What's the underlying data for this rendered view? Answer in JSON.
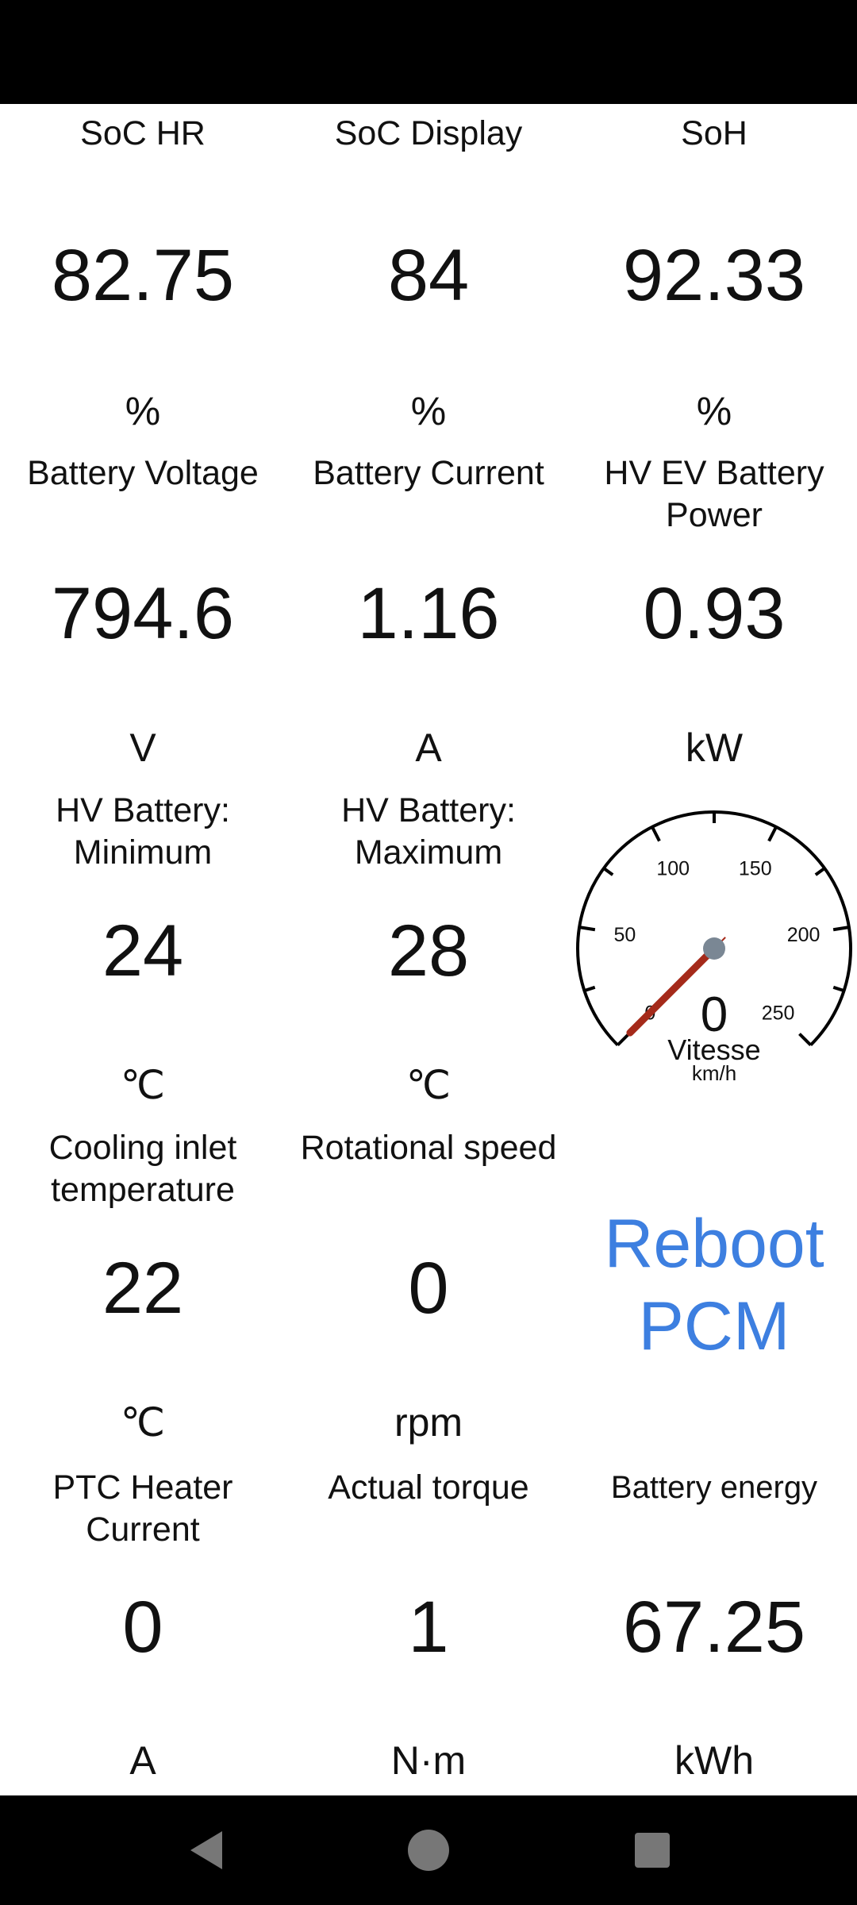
{
  "colors": {
    "accent": "#3d7fe0",
    "needle": "#a52a1a",
    "hub": "#7a8794"
  },
  "cells": [
    {
      "label": "SoC HR",
      "value": "82.75",
      "unit": "%"
    },
    {
      "label": "SoC Display",
      "value": "84",
      "unit": "%"
    },
    {
      "label": "SoH",
      "value": "92.33",
      "unit": "%"
    },
    {
      "label": "Battery Voltage",
      "value": "794.6",
      "unit": "V"
    },
    {
      "label": "Battery Current",
      "value": "1.16",
      "unit": "A"
    },
    {
      "label": "HV EV Battery Power",
      "value": "0.93",
      "unit": "kW"
    },
    {
      "label": "HV Battery: Minimum",
      "value": "24",
      "unit": "℃"
    },
    {
      "label": "HV Battery: Maximum",
      "value": "28",
      "unit": "℃"
    },
    {
      "label": "Cooling inlet temperature",
      "value": "22",
      "unit": "℃"
    },
    {
      "label": "Rotational speed",
      "value": "0",
      "unit": "rpm"
    },
    {
      "label": "PTC Heater Current",
      "value": "0",
      "unit": "A"
    },
    {
      "label": "Actual torque",
      "value": "1",
      "unit": "N·m"
    },
    {
      "label": "Battery energy",
      "value": "67.25",
      "unit": "kWh"
    }
  ],
  "gauge": {
    "value": "0",
    "title": "Vitesse",
    "unit": "km/h",
    "min": 0,
    "max": 250,
    "ticks": [
      "0",
      "50",
      "100",
      "150",
      "200",
      "250"
    ],
    "needle_value": 0
  },
  "reboot_button": {
    "line1": "Reboot",
    "line2": "PCM"
  },
  "nav": {
    "back": "back-icon",
    "home": "home-icon",
    "recents": "recents-icon"
  }
}
